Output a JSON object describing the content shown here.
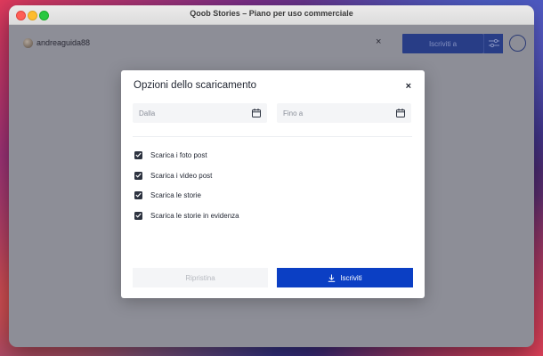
{
  "window": {
    "title": "Qoob Stories – Piano per uso commerciale"
  },
  "appbar": {
    "username": "andreaguida88",
    "close_glyph": "×",
    "subscribe_label": "Iscriviti a",
    "icons": [
      "avatar",
      "close-icon",
      "filter-sliders-icon",
      "profile-circle-icon"
    ]
  },
  "dialog": {
    "title": "Opzioni dello scaricamento",
    "close_glyph": "×",
    "date_from": {
      "placeholder": "Dalla",
      "value": ""
    },
    "date_to": {
      "placeholder": "Fino a",
      "value": ""
    },
    "options": [
      {
        "label": "Scarica i foto post",
        "checked": true
      },
      {
        "label": "Scarica i video post",
        "checked": true
      },
      {
        "label": "Scarica le storie",
        "checked": true
      },
      {
        "label": "Scarica le storie in evidenza",
        "checked": true
      }
    ],
    "reset_label": "Ripristina",
    "subscribe_label": "Iscriviti"
  },
  "colors": {
    "accent": "#0b3fc4",
    "accent_dimmed": "#283d86",
    "overlay": "#8d8e97"
  }
}
